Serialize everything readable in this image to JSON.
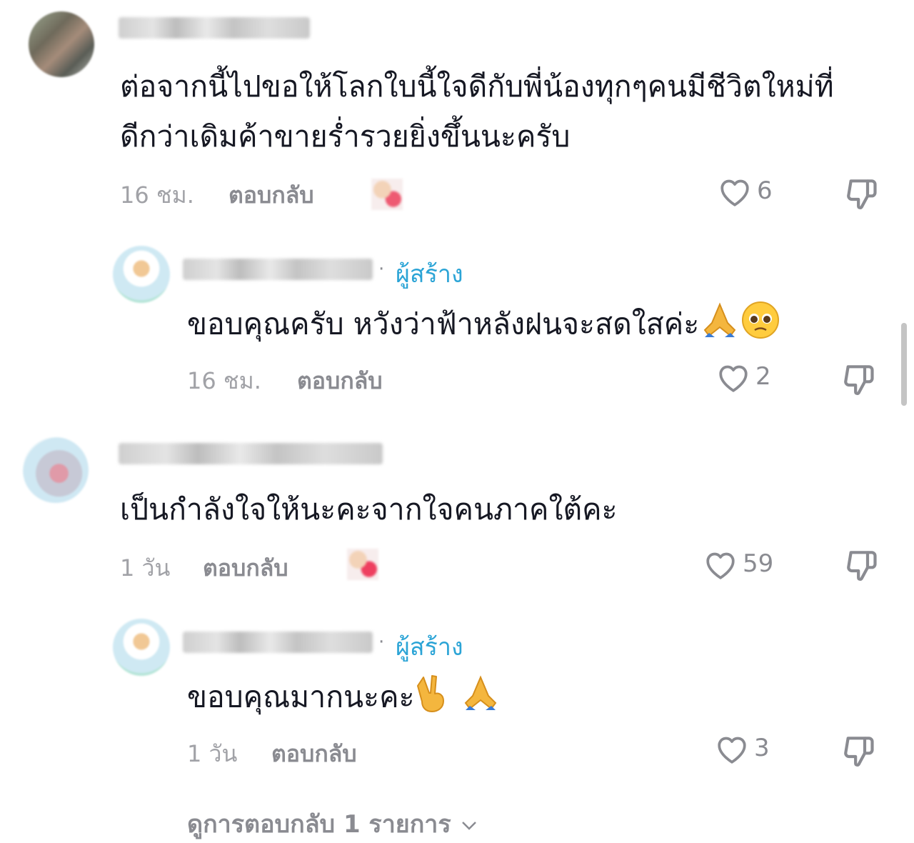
{
  "comments": [
    {
      "text_line1": "ต่อจากนี้ไปขอให้โลกใบนี้ใจดีกับพี่น้องทุกๆคนมีชีวิตใหม่ที่",
      "text_line2": "ดีกว่าเดิมค้าขายร่ำรวยยิ่งขึ้นนะครับ",
      "time": "16 ชม.",
      "reply_label": "ตอบกลับ",
      "likes": "6"
    },
    {
      "creator_label": "ผู้สร้าง",
      "dot": "·",
      "text": "ขอบคุณครับ หวังว่าฟ้าหลังฝนจะสดใสค่ะ",
      "time": "16 ชม.",
      "reply_label": "ตอบกลับ",
      "likes": "2"
    },
    {
      "text_line1": "เป็นกำลังใจให้นะคะจากใจคนภาคใต้คะ",
      "time": "1 วัน",
      "reply_label": "ตอบกลับ",
      "likes": "59"
    },
    {
      "creator_label": "ผู้สร้าง",
      "dot": "·",
      "text": "ขอบคุณมากนะคะ",
      "time": "1 วัน",
      "reply_label": "ตอบกลับ",
      "likes": "3"
    }
  ],
  "more_replies": "ดูการตอบกลับ 1 รายการ",
  "icons": {
    "like": "heart-outline-icon",
    "dislike": "thumbs-down-icon",
    "pray": "folded-hands-emoji",
    "pleading": "pleading-face-emoji",
    "peace": "victory-hand-emoji",
    "expand": "chevron-down-icon"
  },
  "colors": {
    "text": "#161823",
    "muted": "#a1a2a7",
    "creator": "#2ba4d6"
  }
}
